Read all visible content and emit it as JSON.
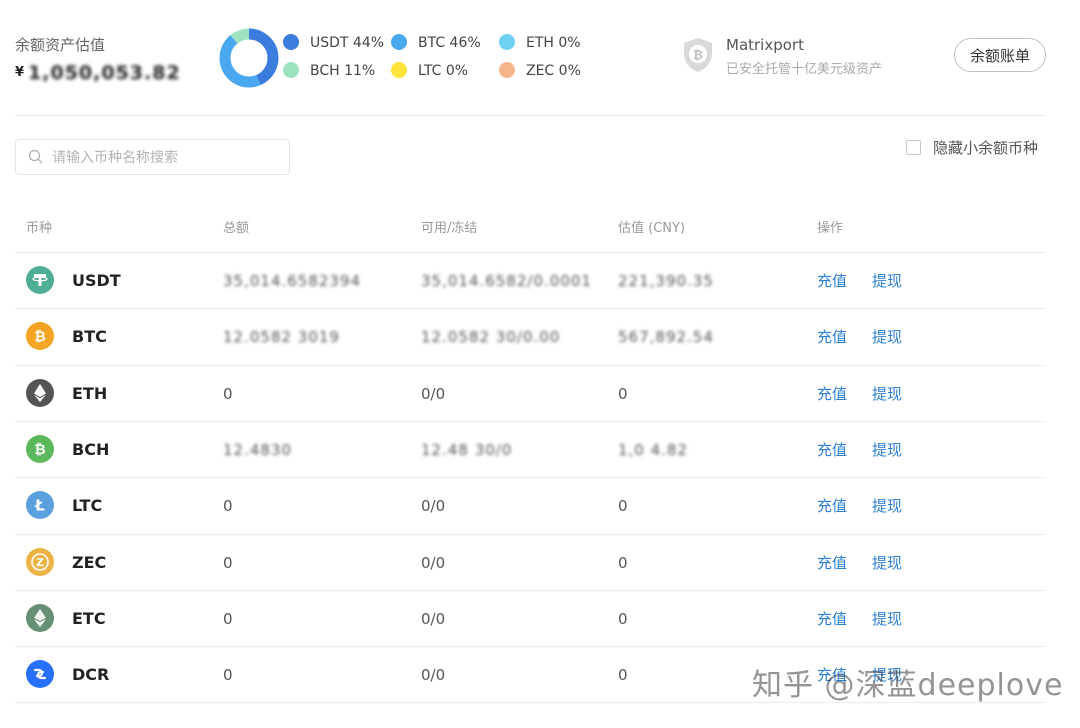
{
  "header": {
    "balance_label": "余额资产估值",
    "currency_symbol": "¥",
    "balance_value": "1,050,053.82",
    "legend": [
      {
        "label": "USDT 44%",
        "color": "#3b7ddd",
        "percent": 44
      },
      {
        "label": "BTC 46%",
        "color": "#4aa8f0",
        "percent": 46
      },
      {
        "label": "ETH 0%",
        "color": "#6fd2f2",
        "percent": 0
      },
      {
        "label": "BCH 11%",
        "color": "#9ee3c0",
        "percent": 11
      },
      {
        "label": "LTC 0%",
        "color": "#ffe23a",
        "percent": 0
      },
      {
        "label": "ZEC 0%",
        "color": "#f7b58c",
        "percent": 0
      }
    ],
    "custodian_name": "Matrixport",
    "custodian_desc": "已安全托管十亿美元级资产",
    "ledger_button": "余额账单"
  },
  "filters": {
    "search_placeholder": "请输入币种名称搜索",
    "hide_small_label": "隐藏小余额币种"
  },
  "table": {
    "headers": [
      "币种",
      "总额",
      "可用/冻结",
      "估值 (CNY)",
      "操作"
    ],
    "rows": [
      {
        "coin": "USDT",
        "icon_color": "#4fae96",
        "icon": "tether-icon",
        "total": "35,014.6582394",
        "available": "35,014.6582/0.0001",
        "estimate": "221,390.35",
        "blurred": true
      },
      {
        "coin": "BTC",
        "icon_color": "#f4a623",
        "icon": "bitcoin-icon",
        "total": "12.0582 3019",
        "available": "12.0582 30/0.00",
        "estimate": "567,892.54",
        "blurred": true
      },
      {
        "coin": "ETH",
        "icon_color": "#555555",
        "icon": "ethereum-icon",
        "total": "0",
        "available": "0/0",
        "estimate": "0",
        "blurred": false
      },
      {
        "coin": "BCH",
        "icon_color": "#5cb85c",
        "icon": "bitcoin-cash-icon",
        "total": "12.4830",
        "available": "12.48 30/0",
        "estimate": "1,0 4.82",
        "blurred": true
      },
      {
        "coin": "LTC",
        "icon_color": "#5aa0de",
        "icon": "litecoin-icon",
        "total": "0",
        "available": "0/0",
        "estimate": "0",
        "blurred": false
      },
      {
        "coin": "ZEC",
        "icon_color": "#ecb244",
        "icon": "zcash-icon",
        "total": "0",
        "available": "0/0",
        "estimate": "0",
        "blurred": false
      },
      {
        "coin": "ETC",
        "icon_color": "#669073",
        "icon": "ethereum-classic-icon",
        "total": "0",
        "available": "0/0",
        "estimate": "0",
        "blurred": false
      },
      {
        "coin": "DCR",
        "icon_color": "#2970ff",
        "icon": "decred-icon",
        "total": "0",
        "available": "0/0",
        "estimate": "0",
        "blurred": false
      }
    ],
    "action_deposit": "充值",
    "action_withdraw": "提现"
  },
  "watermark": "知乎 @深蓝deeplove"
}
